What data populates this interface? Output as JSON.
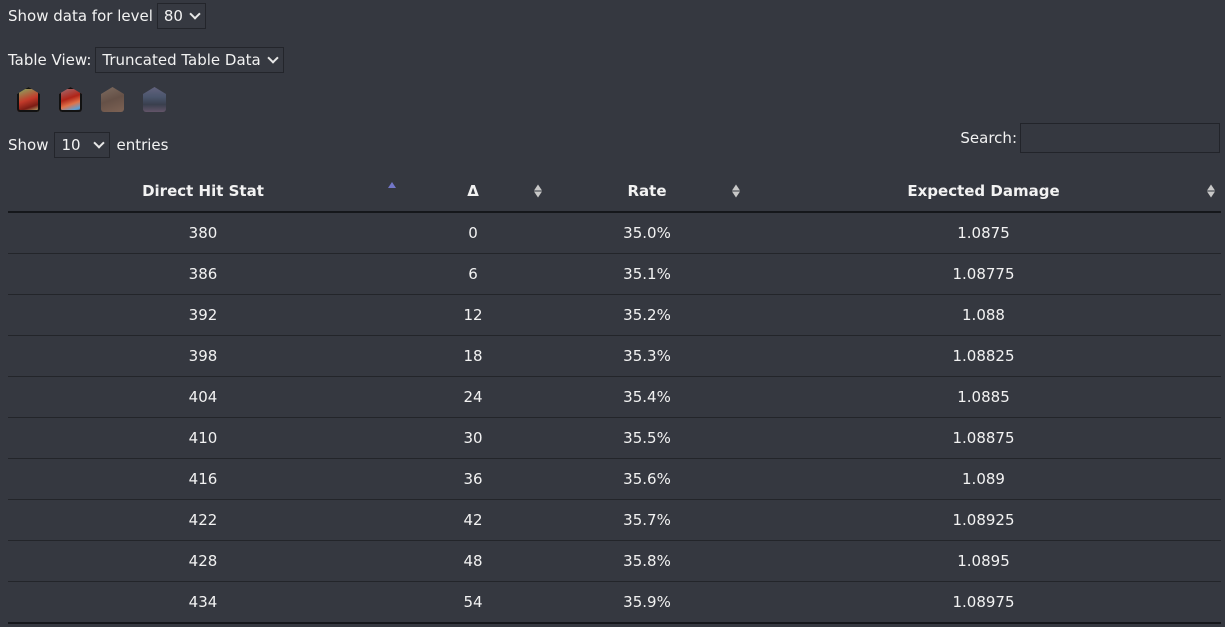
{
  "level_selector": {
    "label": "Show data for level",
    "selected": "80"
  },
  "table_view": {
    "label": "Table View:",
    "selected": "Truncated Table Data"
  },
  "job_icons": [
    {
      "name": "job-icon-1",
      "active": true
    },
    {
      "name": "job-icon-2",
      "active": true
    },
    {
      "name": "job-icon-3",
      "active": false
    },
    {
      "name": "job-icon-4",
      "active": false
    }
  ],
  "length_menu": {
    "prefix": "Show",
    "selected": "10",
    "suffix": "entries"
  },
  "search": {
    "label": "Search:",
    "value": "",
    "placeholder": ""
  },
  "table": {
    "columns": [
      {
        "label": "Direct Hit Stat",
        "sort": "ascending"
      },
      {
        "label": "Δ",
        "sort": "none"
      },
      {
        "label": "Rate",
        "sort": "none"
      },
      {
        "label": "Expected Damage",
        "sort": "none"
      }
    ],
    "rows": [
      [
        "380",
        "0",
        "35.0%",
        "1.0875"
      ],
      [
        "386",
        "6",
        "35.1%",
        "1.08775"
      ],
      [
        "392",
        "12",
        "35.2%",
        "1.088"
      ],
      [
        "398",
        "18",
        "35.3%",
        "1.08825"
      ],
      [
        "404",
        "24",
        "35.4%",
        "1.0885"
      ],
      [
        "410",
        "30",
        "35.5%",
        "1.08875"
      ],
      [
        "416",
        "36",
        "35.6%",
        "1.089"
      ],
      [
        "422",
        "42",
        "35.7%",
        "1.08925"
      ],
      [
        "428",
        "48",
        "35.8%",
        "1.0895"
      ],
      [
        "434",
        "54",
        "35.9%",
        "1.08975"
      ]
    ]
  },
  "colors": {
    "background": "#353840",
    "text": "#f2f2f2",
    "sort_active": "#7377c9"
  }
}
